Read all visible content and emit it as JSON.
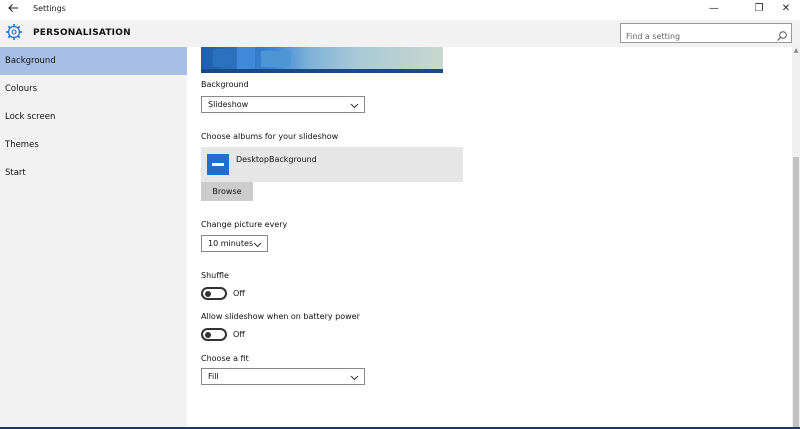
{
  "window": {
    "title": "Settings",
    "back_icon": "back-arrow-icon",
    "minimize_label": "—",
    "maximize_label": "❐",
    "close_label": "✕"
  },
  "header": {
    "title": "PERSONALISATION",
    "icon": "gear-icon",
    "search_placeholder": "Find a setting",
    "search_icon": "search-icon"
  },
  "sidebar": {
    "items": [
      {
        "label": "Background",
        "active": true
      },
      {
        "label": "Colours",
        "active": false
      },
      {
        "label": "Lock screen",
        "active": false
      },
      {
        "label": "Themes",
        "active": false
      },
      {
        "label": "Start",
        "active": false
      }
    ]
  },
  "main": {
    "background_label": "Background",
    "background_value": "Slideshow",
    "albums_label": "Choose albums for your slideshow",
    "album_name": "DesktopBackground",
    "browse_label": "Browse",
    "change_picture_label": "Change picture every",
    "change_picture_value": "10 minutes",
    "shuffle_label": "Shuffle",
    "shuffle_state": "Off",
    "battery_label": "Allow slideshow when on battery power",
    "battery_state": "Off",
    "fit_label": "Choose a fit",
    "fit_value": "Fill"
  },
  "colors": {
    "accent": "#a7bfe6",
    "sidebar_bg": "#f2f2f2",
    "album_icon": "#1f6fcf"
  }
}
